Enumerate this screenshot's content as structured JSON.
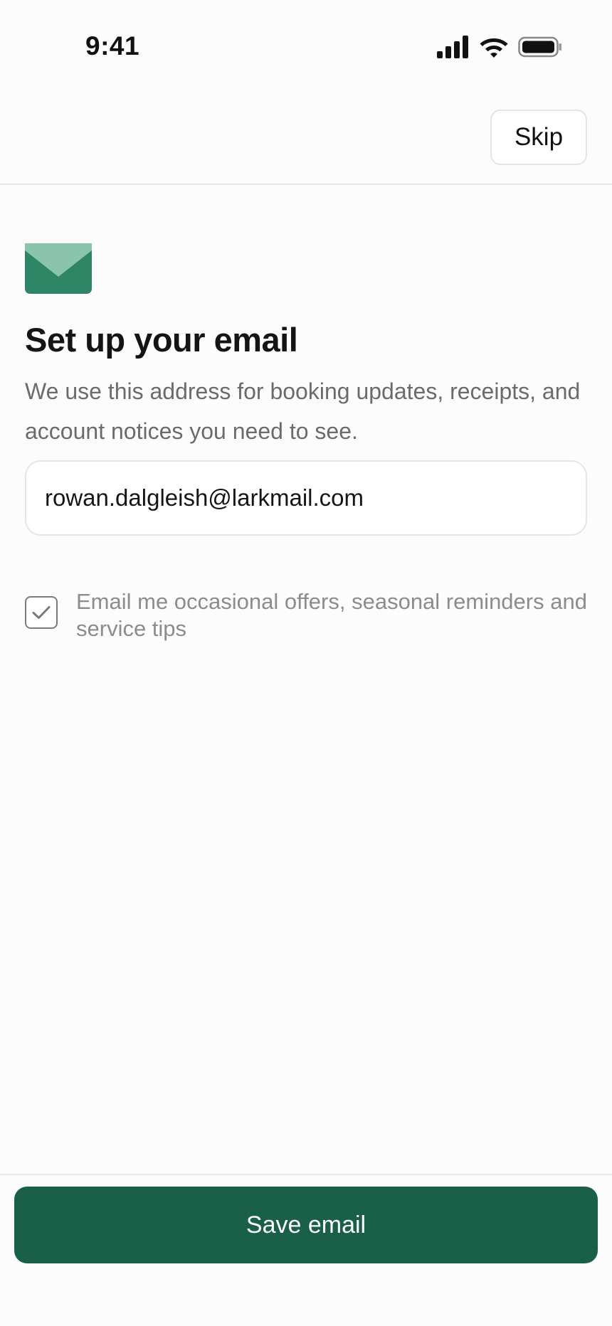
{
  "status_bar": {
    "time": "9:41",
    "icons": [
      "cellular-signal-icon",
      "wifi-icon",
      "battery-icon"
    ]
  },
  "nav": {
    "skip_label": "Skip"
  },
  "header": {
    "icon": "envelope-icon",
    "title": "Set up your email",
    "subtitle": "We use this address for booking updates, receipts, and account notices you need to see."
  },
  "form": {
    "email_value": "rowan.dalgleish@larkmail.com",
    "marketing_opt_in": {
      "checked": true,
      "label": "Email me occasional offers, seasonal reminders and service tips"
    }
  },
  "footer": {
    "save_label": "Save email"
  },
  "colors": {
    "accent": "#1a5f48",
    "icon_dark": "#2e8565",
    "icon_light": "#8ac4ac",
    "background": "#fcfcfc",
    "muted_text": "#6b6b6b"
  }
}
